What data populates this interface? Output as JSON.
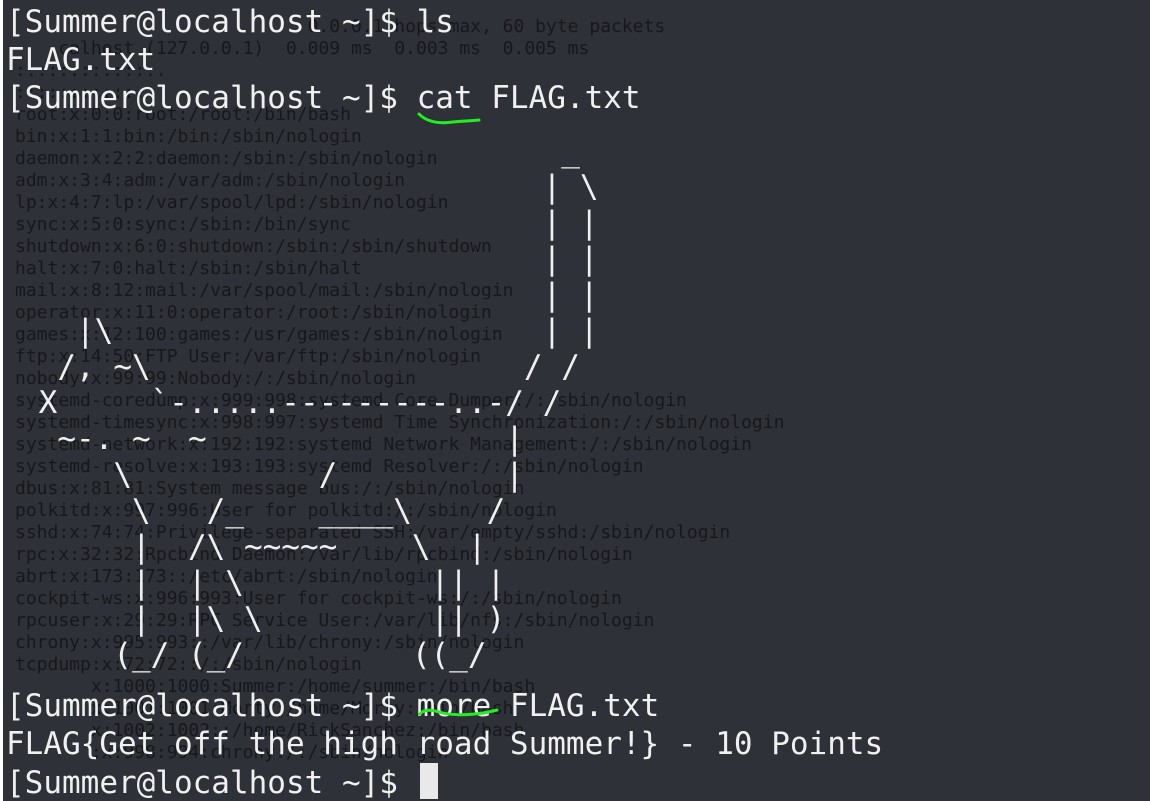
{
  "terminal": {
    "background_color": "#2f3138",
    "foreground_color": "#f0f0f0",
    "annotation_color": "#22ee22",
    "background_text": [
      "                           0.0.0.1 hops max, 60 byte packets",
      "    calhost (127.0.0.1)  0.009 ms  0.003 ms  0.005 ms",
      ":::::::::::::.",
      ":::::::::::.",
      "root:x:0:0:root:/root:/bin/bash",
      "bin:x:1:1:bin:/bin:/sbin/nologin",
      "daemon:x:2:2:daemon:/sbin:/sbin/nologin",
      "adm:x:3:4:adm:/var/adm:/sbin/nologin",
      "lp:x:4:7:lp:/var/spool/lpd:/sbin/nologin",
      "sync:x:5:0:sync:/sbin:/bin/sync",
      "shutdown:x:6:0:shutdown:/sbin:/sbin/shutdown",
      "halt:x:7:0:halt:/sbin:/sbin/halt",
      "mail:x:8:12:mail:/var/spool/mail:/sbin/nologin",
      "operator:x:11:0:operator:/root:/sbin/nologin",
      "games:x:12:100:games:/usr/games:/sbin/nologin",
      "ftp:x:14:50:FTP User:/var/ftp:/sbin/nologin",
      "nobody:x:99:99:Nobody:/:/sbin/nologin",
      "systemd-coredump:x:999:998:systemd Core Dumper:/:/sbin/nologin",
      "systemd-timesync:x:998:997:systemd Time Synchronization:/:/sbin/nologin",
      "systemd-network:x:192:192:systemd Network Management:/:/sbin/nologin",
      "systemd-resolve:x:193:193:systemd Resolver:/:/sbin/nologin",
      "dbus:x:81:81:System message bus:/:/sbin/nologin",
      "polkitd:x:997:996:User for polkitd:/:/sbin/nologin",
      "sshd:x:74:74:Privilege-separated SSH:/var/empty/sshd:/sbin/nologin",
      "rpc:x:32:32:Rpcbind Daemon:/var/lib/rpcbind:/sbin/nologin",
      "abrt:x:173:173::/etc/abrt:/sbin/nologin",
      "cockpit-ws:x:996:993:User for cockpit-ws:/:/sbin/nologin",
      "rpcuser:x:29:29:RPC Service User:/var/lib/nfs:/sbin/nologin",
      "chrony:x:995:993::/var/lib/chrony:/sbin/nologin",
      "tcpdump:x:72:72::/:/sbin/nologin",
      "       x:1000:1000:Summer:/home/summer:/bin/bash",
      "       x:1001:1001:Morty:/home/Morty:/bin/bash",
      "       x:1002:1002::/home/RickSanchez:/bin/bash",
      "       :x:998:994:chrony:/:/sbin/nologin"
    ],
    "lines": [
      {
        "prompt": "[Summer@localhost ~]$ ",
        "command": "ls"
      },
      {
        "output": "FLAG.txt"
      },
      {
        "prompt": "[Summer@localhost ~]$ ",
        "command": "cat",
        "args": " FLAG.txt"
      },
      {
        "prompt": "[Summer@localhost ~]$ ",
        "command": "more",
        "args": " FLAG.txt"
      },
      {
        "output": "FLAG{Get off the high road Summer!} - 10 Points"
      },
      {
        "prompt": "[Summer@localhost ~]$ "
      }
    ],
    "ascii_art": [
      "                             _",
      "                            | \\",
      "                            | |",
      "                            | |",
      "                            | |",
      "   |\\                       | |",
      "  /, ~\\                    / /",
      " X     `-.....---------..-/ /",
      "  ~-. ~  ~                |",
      "     \\          /         |",
      "      \\   /_    ____\\    /",
      "      |  /\\ ~~~~~    \\  |",
      "      |  | \\          || |",
      "      |  |\\ \\         || )",
      "     (_/ (_/         ((_/"
    ]
  }
}
